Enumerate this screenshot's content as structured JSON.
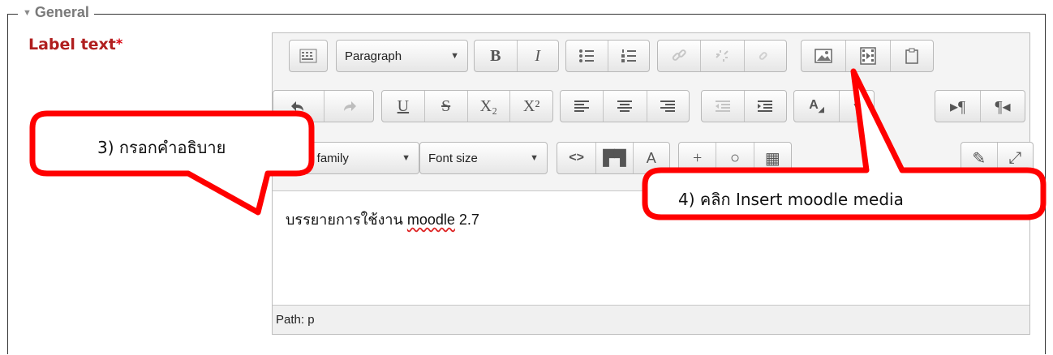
{
  "section": {
    "title": "General",
    "toggle_icon": "triangle-down-icon"
  },
  "field": {
    "label": "Label text",
    "required_mark": "*"
  },
  "editor": {
    "toolbar": {
      "paragraph_select": "Paragraph",
      "bold": "B",
      "italic": "I",
      "underline": "U",
      "strike": "S",
      "subscript": "X₂",
      "superscript": "X²",
      "font_family_select": "nt family",
      "font_size_select": "Font size"
    },
    "content": {
      "text_before": "บรรยายการใช้งาน ",
      "misspelled_word": "moodle",
      "text_after": " 2.7"
    },
    "path": "Path: p"
  },
  "callouts": {
    "step3": "3)  กรอกคำอธิบาย",
    "step4": "4) คลิก Insert moodle media"
  }
}
